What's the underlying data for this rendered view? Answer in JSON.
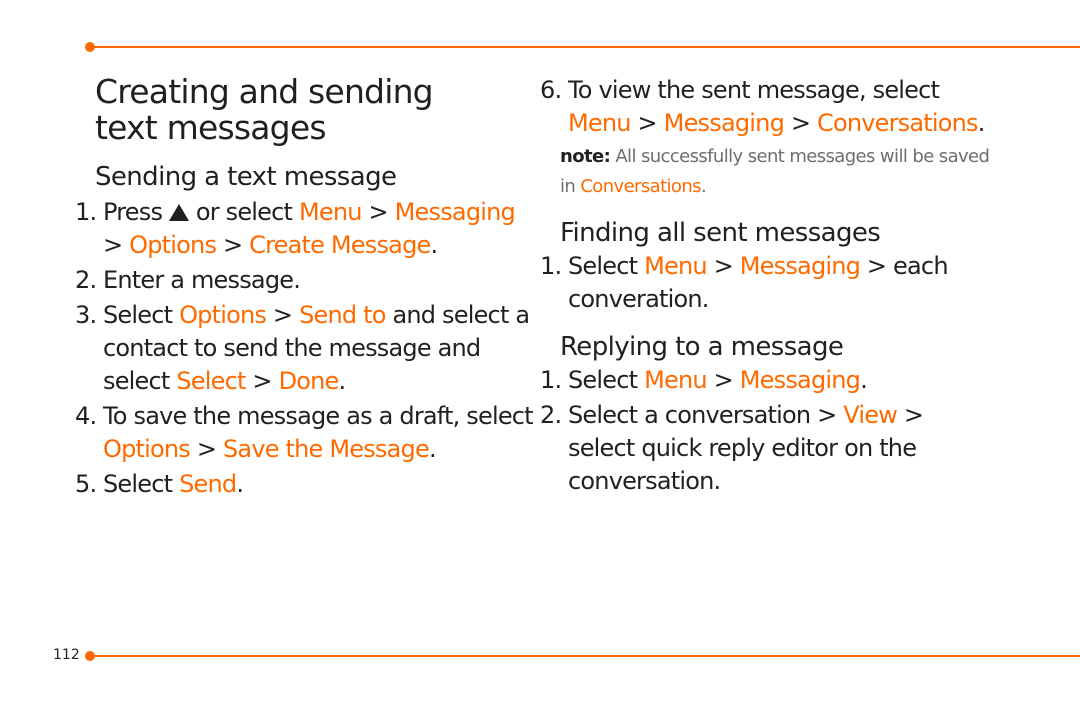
{
  "page_number": "112",
  "title": "Creating and sending text messages",
  "title_line1": "Creating and sending",
  "title_line2": "text messages",
  "accent_color": "#ff6a00",
  "sections": {
    "sending": {
      "heading": "Sending a text message",
      "steps": [
        {
          "num": "1.",
          "parts": [
            "Press ",
            "up-key-icon",
            " or select ",
            "Menu",
            " > ",
            "Messaging",
            " > ",
            "Options",
            " > ",
            "Create Message",
            "."
          ]
        },
        {
          "num": "2.",
          "text": "Enter a message."
        },
        {
          "num": "3.",
          "parts": [
            "Select ",
            "Options",
            " > ",
            "Send to",
            " and select a contact to send the message and select ",
            "Select",
            " > ",
            "Done",
            "."
          ]
        },
        {
          "num": "4.",
          "parts": [
            "To save the message as a draft, select ",
            "Options",
            " > ",
            "Save the Message",
            "."
          ]
        },
        {
          "num": "5.",
          "parts": [
            "Select ",
            "Send",
            "."
          ]
        },
        {
          "num": "6.",
          "parts": [
            "To view the sent message, select ",
            "Menu",
            " > ",
            "Messaging",
            " > ",
            "Conversations",
            "."
          ]
        }
      ],
      "note_label": "note:",
      "note_text": " All successfully sent messages will be saved in ",
      "note_link": "Conversations",
      "note_end": "."
    },
    "finding": {
      "heading": "Finding all sent messages",
      "steps": [
        {
          "num": "1.",
          "parts": [
            "Select ",
            "Menu",
            " > ",
            "Messaging",
            " > each converation."
          ]
        }
      ]
    },
    "replying": {
      "heading": "Replying to a message",
      "steps": [
        {
          "num": "1.",
          "parts": [
            "Select ",
            "Menu",
            " > ",
            "Messaging",
            "."
          ]
        },
        {
          "num": "2.",
          "parts": [
            "Select a conversation > ",
            "View",
            " > select quick reply editor on the conversation."
          ]
        }
      ]
    }
  }
}
